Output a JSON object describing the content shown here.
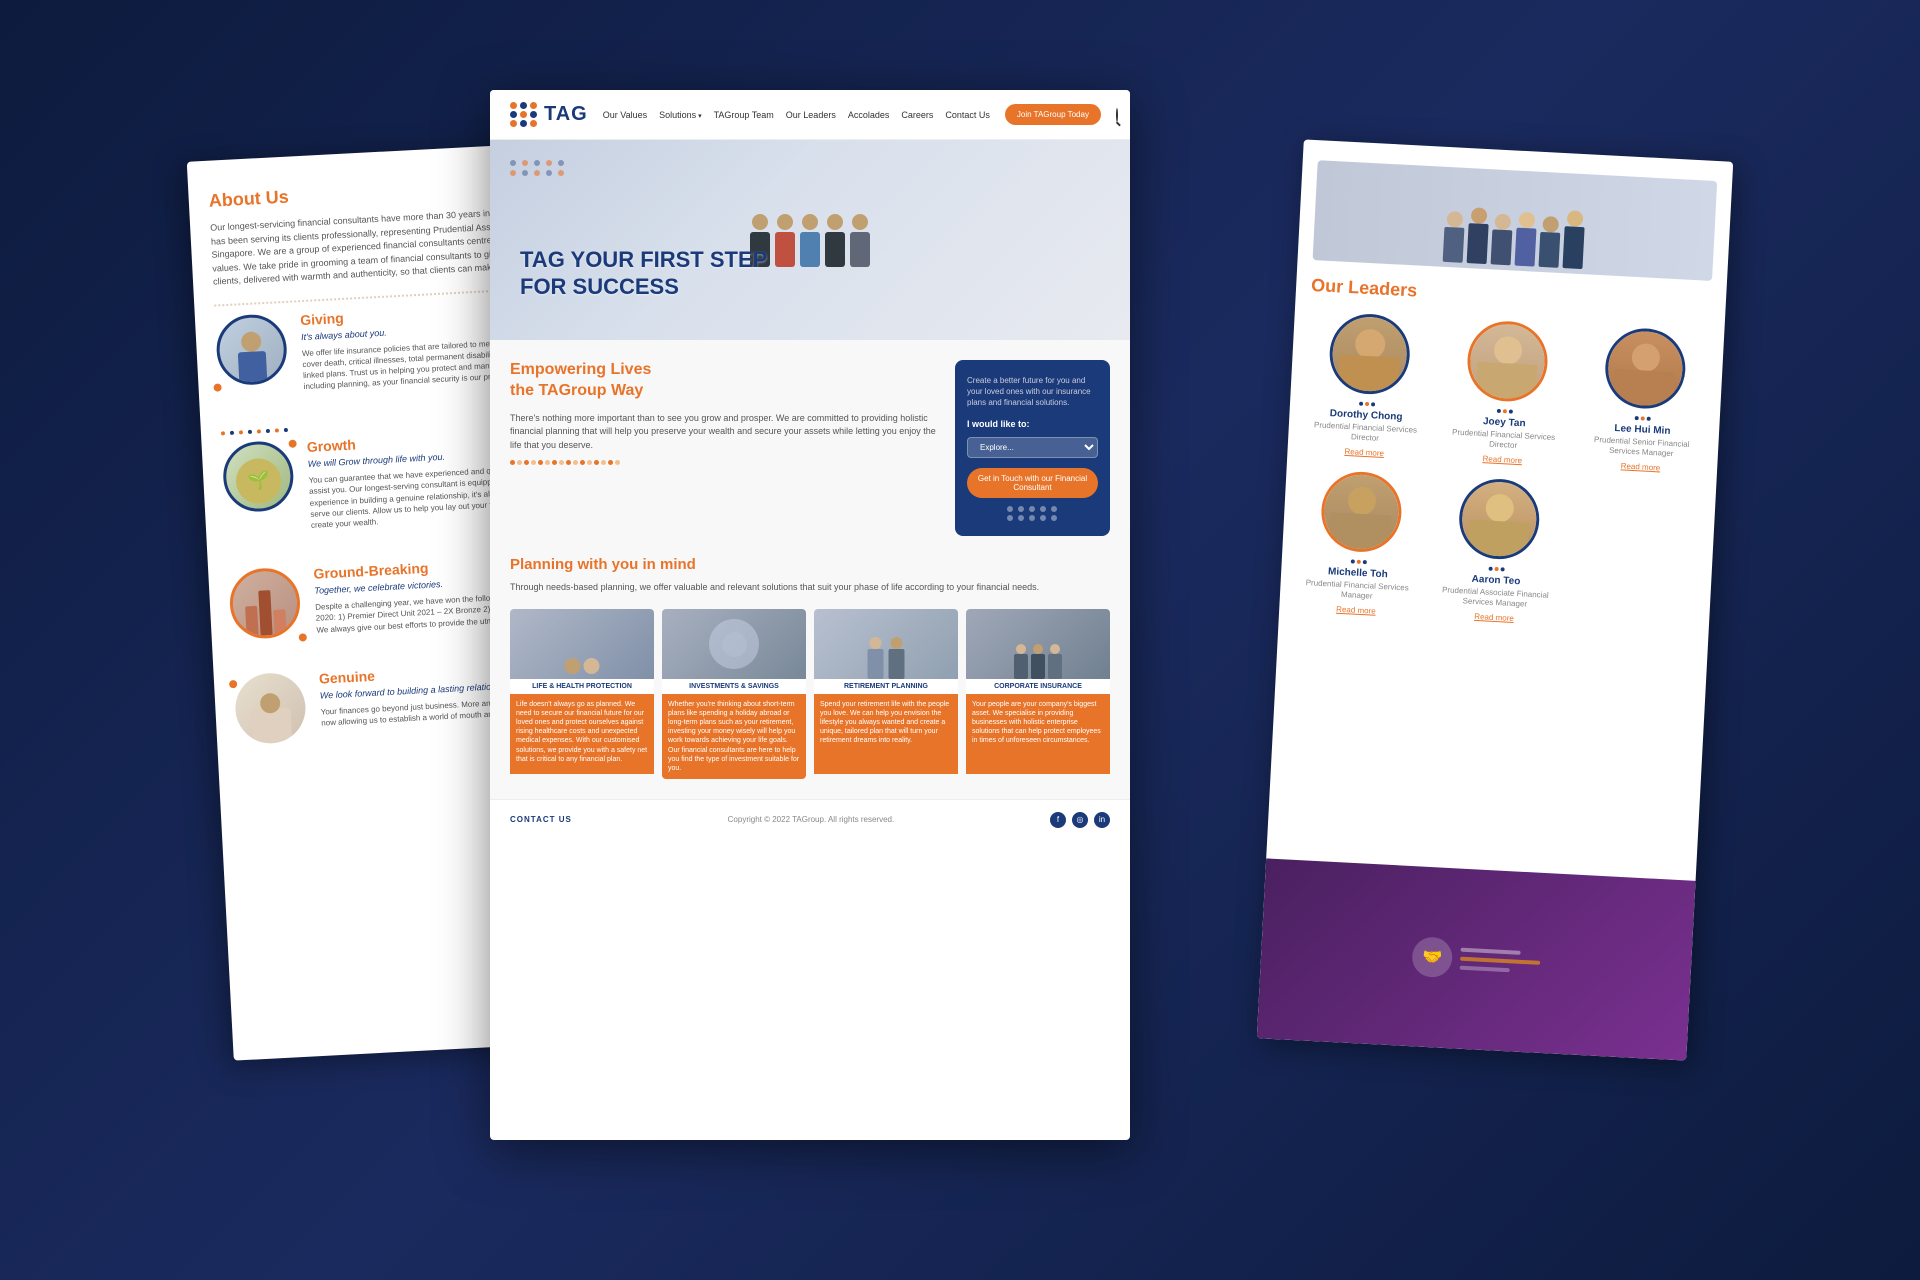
{
  "background_color": "#1a2a4a",
  "nav": {
    "logo_text": "TAG",
    "links": [
      "Our Values",
      "Solutions",
      "TAGroup Team",
      "Our Leaders",
      "Accolades",
      "Careers",
      "Contact Us"
    ],
    "solutions_has_dropdown": true,
    "cta_button": "Join TAGroup Today",
    "search_label": "search"
  },
  "hero": {
    "title_line1": "TAG YOUR FIRST STEP",
    "title_line2": "FOR SUCCESS"
  },
  "empowering": {
    "heading_line1": "Empowering Lives",
    "heading_line2": "the TAGroup Way",
    "body": "There's nothing more important than to see you grow and prosper. We are committed to providing holistic financial planning that will help you preserve your wealth and secure your assets while letting you enjoy the life that you deserve."
  },
  "card": {
    "description": "Create a better future for you and your loved ones with our insurance plans and financial solutions.",
    "label": "I would like to:",
    "select_placeholder": "Explore...",
    "button_label": "Get in Touch with our Financial Consultant"
  },
  "planning": {
    "heading": "Planning with you in mind",
    "body": "Through needs-based planning, we offer valuable and relevant solutions that suit your phase of life according to your financial needs."
  },
  "services": [
    {
      "title": "LIFE & HEALTH PROTECTION",
      "description": "Life doesn't always go as planned. We need to secure our financial future for our loved ones and protect ourselves against rising healthcare costs and unexpected medical expenses. With our customised solutions, we provide you with a safety net that is critical to any financial plan."
    },
    {
      "title": "INVESTMENTS & SAVINGS",
      "description": "Whether you're thinking about short-term plans like spending a holiday abroad or long-term plans such as your retirement, investing your money wisely will help you work towards achieving your life goals. Our financial consultants are here to help you find the type of investment suitable for you."
    },
    {
      "title": "RETIREMENT PLANNING",
      "description": "Spend your retirement life with the people you love. We can help you envision the lifestyle you always wanted and create a unique, tailored plan that will turn your retirement dreams into reality."
    },
    {
      "title": "CORPORATE INSURANCE",
      "description": "Your people are your company's biggest asset. We specialise in providing businesses with holistic enterprise solutions that can help protect employees in times of unforeseen circumstances."
    }
  ],
  "footer": {
    "contact_label": "CONTACT US",
    "copyright": "Copyright © 2022 TAGroup. All rights reserved.",
    "social_icons": [
      "facebook",
      "instagram",
      "linkedin"
    ]
  },
  "left_page": {
    "title": "About Us",
    "intro": "Our longest-servicing financial consultants have more than 30 years in the business. TAGroup has been serving its clients professionally, representing Prudential Assurance Company Singapore. We are a group of experienced financial consultants centred around our Core 4C values. We take pride in grooming a team of financial consultants to give professional advice to clients, delivered with warmth and authenticity, so that clients can make a difference in their lives.",
    "sections": [
      {
        "title": "Giving",
        "tagline": "It's always about you.",
        "body": "We offer life insurance policies that are tailored to meet your financial needs that cover death, critical illnesses, total permanent disability and includes investment-linked plans. Trust us in helping you protect and manage your money finances including planning, as your financial security is our priority."
      },
      {
        "title": "Growth",
        "tagline": "We will Grow through life with you.",
        "body": "You can guarantee that we have experienced and qualified financial consultants to assist you. Our longest-serving consultant is equipped with more than 20 years' experience in building a genuine relationship, it's always our focus to engage & to serve our clients. Allow us to help you lay out your financial plans, to you grow, and create your wealth."
      },
      {
        "title": "Ground-Breaking",
        "tagline": "Together, we celebrate victories.",
        "body": "Despite a challenging year, we have won the following awards at Agency Convention 2020: 1) Premier Direct Unit 2021 – 2X Bronze 2) Premier AL Group 2021 – 1X Gold We always give our best efforts to provide the utmost care for our clients."
      },
      {
        "title": "Genuine",
        "tagline": "We look forward to building a lasting relationship with you.",
        "body": "Your finances go beyond just business. More and more clients are trusting us and now allowing us to establish a world of mouth and referrals."
      }
    ]
  },
  "right_page": {
    "title": "Our Leaders",
    "leaders": [
      {
        "name": "Dorothy Chong",
        "title": "Prudential Financial Services Director",
        "read_more": "Read more"
      },
      {
        "name": "Joey Tan",
        "title": "Prudential Financial Services Director",
        "read_more": "Read more"
      },
      {
        "name": "Lee Hui Min",
        "title": "Prudential Senior Financial Services Manager",
        "read_more": "Read more"
      },
      {
        "name": "Michelle Toh",
        "title": "Prudential Financial Services Manager",
        "read_more": "Read more"
      },
      {
        "name": "Aaron Teo",
        "title": "Prudential Associate Financial Services Manager",
        "read_more": "Read more"
      }
    ]
  }
}
